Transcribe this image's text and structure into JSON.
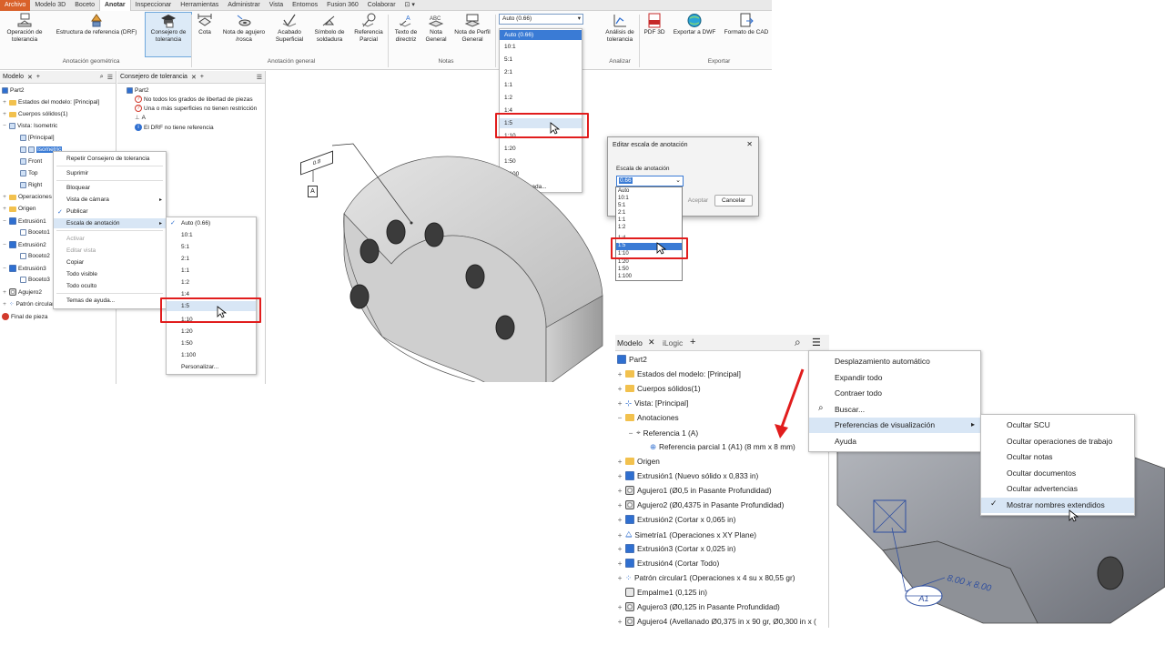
{
  "ribbon": {
    "tabs": [
      "Archivo",
      "Modelo 3D",
      "Boceto",
      "Anotar",
      "Inspeccionar",
      "Herramientas",
      "Administrar",
      "Vista",
      "Entornos",
      "Fusion 360",
      "Colaborar",
      "⊡ ▾"
    ],
    "buttons": {
      "op_tol": "Operación de tolerancia",
      "drf": "Estructura de referencia (DRF)",
      "consejo": "Consejero de tolerancia",
      "cota": "Cota",
      "nota_agujero": "Nota de agujero /rosca",
      "acabado": "Acabado Superficial",
      "simbolo": "Símbolo de soldadura",
      "ref_parcial": "Referencia Parcial",
      "texto_dir": "Texto de directriz",
      "nota_gen": "Nota General",
      "nota_perfil": "Nota de Perfil General",
      "analisis": "Análisis de tolerancia",
      "pdf3d": "PDF 3D",
      "dwf": "Exportar a DWF",
      "cad": "Formato de CAD"
    },
    "groups": [
      "Anotación geométrica",
      "Anotación general",
      "Notas",
      "Analizar",
      "Exportar"
    ]
  },
  "scale_dropdown": {
    "value": "Auto (0.66)",
    "options": [
      "Auto (0.66)",
      "10:1",
      "5:1",
      "2:1",
      "1:1",
      "1:2",
      "1:4",
      "1:5",
      "1:10",
      "1:20",
      "1:50",
      "1:100",
      "Personalizada..."
    ],
    "highlighted": "1:5"
  },
  "model_panel": {
    "tab": "Modelo",
    "items": [
      "Part2",
      "Estados del modelo: [Principal]",
      "Cuerpos sólidos(1)",
      "Vista: Isometric",
      "[Principal]",
      "Isometric",
      "Front",
      "Top",
      "Right",
      "Operaciones",
      "Origen",
      "Extrusión1",
      "Boceto1",
      "Extrusión2",
      "Boceto2",
      "Extrusión3",
      "Boceto3",
      "Agujero2",
      "Patrón circular1",
      "Final de pieza"
    ]
  },
  "advisor_panel": {
    "tab": "Consejero de tolerancia",
    "root": "Part2",
    "items": [
      "No todos los grados de libertad de piezas",
      "Una o más superficies no tienen restricción",
      "A",
      "El DRF no tiene referencia"
    ]
  },
  "context_menu": {
    "items": [
      "Repetir Consejero de tolerancia",
      "Suprimir",
      "Bloquear",
      "Vista de cámara",
      "Publicar",
      "Escala de anotación",
      "Activar",
      "Editar vista",
      "Copiar",
      "Todo visible",
      "Todo oculto",
      "Temas de ayuda..."
    ],
    "submenu": [
      "Auto (0.66)",
      "10:1",
      "5:1",
      "2:1",
      "1:1",
      "1:2",
      "1:4",
      "1:5",
      "1:10",
      "1:20",
      "1:50",
      "1:100",
      "Personalizar..."
    ]
  },
  "viewport_labels": {
    "datum": "A",
    "gdt": "0.8"
  },
  "dialog": {
    "title": "Editar escala de anotación",
    "label": "Escala de anotación",
    "value": "0.66",
    "options": [
      "Auto",
      "10:1",
      "5:1",
      "2:1",
      "1:1",
      "1:2",
      "1:4",
      "1:5",
      "1:10",
      "1:20",
      "1:50",
      "1:100"
    ],
    "accept": "Aceptar",
    "cancel": "Cancelar",
    "close": "✕"
  },
  "model_browser2": {
    "tabs": [
      "Modelo",
      "iLogic"
    ],
    "items": [
      "Part2",
      "Estados del modelo: [Principal]",
      "Cuerpos sólidos(1)",
      "Vista: [Principal]",
      "Anotaciones",
      "Referencia 1 (A)",
      "Referencia parcial 1 (A1) (8 mm x 8 mm)",
      "Origen",
      "Extrusión1 (Nuevo sólido x 0,833 in)",
      "Agujero1 (Ø0,5 in Pasante Profundidad)",
      "Agujero2 (Ø0,4375 in Pasante Profundidad)",
      "Extrusión2 (Cortar x 0,065 in)",
      "Simetría1 (Operaciones x XY Plane)",
      "Extrusión3 (Cortar x 0,025 in)",
      "Extrusión4 (Cortar Todo)",
      "Patrón circular1 (Operaciones x 4 su x 80,55 gr)",
      "Empalme1 (0,125 in)",
      "Agujero3 (Ø0,125 in Pasante Profundidad)",
      "Agujero4 (Avellanado Ø0,375 in x 90 gr, Ø0,300 in x ("
    ]
  },
  "browser_menu": {
    "items": [
      "Desplazamiento automático",
      "Expandir todo",
      "Contraer todo",
      "Buscar...",
      "Preferencias de visualización",
      "Ayuda"
    ],
    "submenu": [
      "Ocultar SCU",
      "Ocultar operaciones de trabajo",
      "Ocultar notas",
      "Ocultar documentos",
      "Ocultar advertencias",
      "Mostrar nombres extendidos"
    ],
    "checked": "Mostrar nombres extendidos"
  },
  "part_labels": {
    "ref": "A1",
    "dim": "8.00 x 8.00"
  },
  "colors": {
    "accent": "#2f6fd0",
    "highlight_border": "#e11d1d",
    "file_tab": "#d9612a",
    "selection": "#3a7bd5"
  }
}
